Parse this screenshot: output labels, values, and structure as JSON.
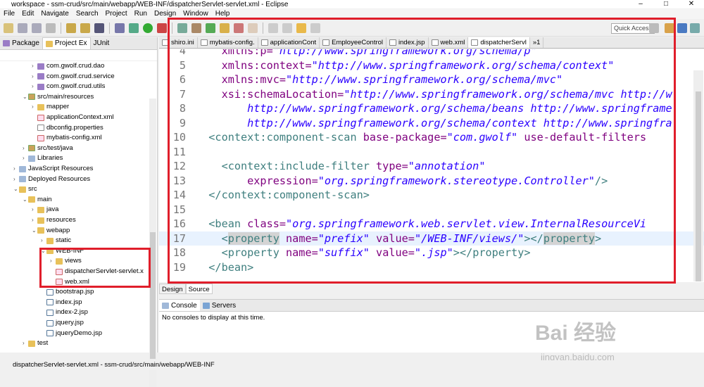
{
  "window": {
    "title": "workspace - ssm-crud/src/main/webapp/WEB-INF/dispatcherServlet-servlet.xml - Eclipse",
    "controls": [
      "–",
      "□",
      "✕"
    ]
  },
  "menu": [
    "File",
    "Edit",
    "Navigate",
    "Search",
    "Project",
    "Run",
    "Design",
    "Window",
    "Help"
  ],
  "quick_access": {
    "placeholder": "Quick Access"
  },
  "left_panel": {
    "tabs": [
      "Package",
      "Project Ex",
      "JUnit"
    ],
    "tree": [
      {
        "label": "com.gwolf.crud.dao",
        "icon": "pkg",
        "indent": 3,
        "arrow": "›"
      },
      {
        "label": "com.gwolf.crud.service",
        "icon": "pkg",
        "indent": 3,
        "arrow": "›"
      },
      {
        "label": "com.gwolf.crud.utils",
        "icon": "pkg",
        "indent": 3,
        "arrow": "›"
      },
      {
        "label": "src/main/resources",
        "icon": "src",
        "indent": 2,
        "arrow": "⌄"
      },
      {
        "label": "mapper",
        "icon": "folder",
        "indent": 3,
        "arrow": "›"
      },
      {
        "label": "applicationContext.xml",
        "icon": "xml",
        "indent": 3,
        "arrow": ""
      },
      {
        "label": "dbconfig.properties",
        "icon": "file",
        "indent": 3,
        "arrow": ""
      },
      {
        "label": "mybatis-config.xml",
        "icon": "xml",
        "indent": 3,
        "arrow": ""
      },
      {
        "label": "src/test/java",
        "icon": "src",
        "indent": 2,
        "arrow": "›"
      },
      {
        "label": "Libraries",
        "icon": "lib",
        "indent": 2,
        "arrow": "›"
      },
      {
        "label": "JavaScript Resources",
        "icon": "lib",
        "indent": 1,
        "arrow": "›"
      },
      {
        "label": "Deployed Resources",
        "icon": "lib",
        "indent": 1,
        "arrow": "›"
      },
      {
        "label": "src",
        "icon": "folder",
        "indent": 1,
        "arrow": "⌄"
      },
      {
        "label": "main",
        "icon": "folder",
        "indent": 2,
        "arrow": "⌄"
      },
      {
        "label": "java",
        "icon": "folder",
        "indent": 3,
        "arrow": "›"
      },
      {
        "label": "resources",
        "icon": "folder",
        "indent": 3,
        "arrow": "›"
      },
      {
        "label": "webapp",
        "icon": "folder",
        "indent": 3,
        "arrow": "⌄"
      },
      {
        "label": "static",
        "icon": "folder",
        "indent": 4,
        "arrow": "›"
      },
      {
        "label": "WEB-INF",
        "icon": "folder",
        "indent": 4,
        "arrow": "⌄"
      },
      {
        "label": "views",
        "icon": "folder",
        "indent": 5,
        "arrow": "›"
      },
      {
        "label": "dispatcherServlet-servlet.x",
        "icon": "xml",
        "indent": 5,
        "arrow": ""
      },
      {
        "label": "web.xml",
        "icon": "xml",
        "indent": 5,
        "arrow": ""
      },
      {
        "label": "bootstrap.jsp",
        "icon": "jsp",
        "indent": 4,
        "arrow": ""
      },
      {
        "label": "index.jsp",
        "icon": "jsp",
        "indent": 4,
        "arrow": ""
      },
      {
        "label": "index-2.jsp",
        "icon": "jsp",
        "indent": 4,
        "arrow": ""
      },
      {
        "label": "jquery.jsp",
        "icon": "jsp",
        "indent": 4,
        "arrow": ""
      },
      {
        "label": "jqueryDemo.jsp",
        "icon": "jsp",
        "indent": 4,
        "arrow": ""
      },
      {
        "label": "test",
        "icon": "folder",
        "indent": 2,
        "arrow": "›"
      }
    ]
  },
  "editor_tabs": [
    {
      "label": "shiro.ini",
      "active": false
    },
    {
      "label": "mybatis-config.",
      "active": false
    },
    {
      "label": "applicationCont",
      "active": false
    },
    {
      "label": "EmployeeControl",
      "active": false
    },
    {
      "label": "index.jsp",
      "active": false
    },
    {
      "label": "web.xml",
      "active": false
    },
    {
      "label": "dispatcherServl",
      "active": true
    },
    {
      "label": "»1",
      "active": false
    }
  ],
  "code_lines": [
    {
      "n": "4",
      "html": "<span class=\"a\">    xmlns:p=</span><span class=\"v\">\"http://www.springframework.org/schema/p\"</span>"
    },
    {
      "n": "5",
      "html": "<span class=\"a\">    xmlns:context=</span><span class=\"v\">\"http://www.springframework.org/schema/context\"</span>"
    },
    {
      "n": "6",
      "html": "<span class=\"a\">    xmlns:mvc=</span><span class=\"v\">\"http://www.springframework.org/schema/mvc\"</span>"
    },
    {
      "n": "7",
      "html": "<span class=\"a\">    xsi:schemaLocation=</span><span class=\"v\">\"http://www.springframework.org/schema/mvc http://w</span>"
    },
    {
      "n": "8",
      "html": "<span class=\"v\">        http://www.springframework.org/schema/beans http://www.springframe</span>"
    },
    {
      "n": "9",
      "html": "<span class=\"v\">        http://www.springframework.org/schema/context http://www.springfra</span>"
    },
    {
      "n": "10",
      "html": "<span class=\"t\">  &lt;context:component-scan </span><span class=\"a\">base-package=</span><span class=\"v\">\"com.gwolf\"</span> <span class=\"a\">use-default-filters</span>"
    },
    {
      "n": "11",
      "html": ""
    },
    {
      "n": "12",
      "html": "<span class=\"t\">    &lt;context:include-filter </span><span class=\"a\">type=</span><span class=\"v\">\"annotation\"</span>"
    },
    {
      "n": "13",
      "html": "<span class=\"a\">        expression=</span><span class=\"v\">\"org.springframework.stereotype.Controller\"</span><span class=\"t\">/&gt;</span>"
    },
    {
      "n": "14",
      "html": "<span class=\"t\">  &lt;/context:component-scan&gt;</span>"
    },
    {
      "n": "15",
      "html": ""
    },
    {
      "n": "16",
      "html": "<span class=\"t\">  &lt;bean </span><span class=\"a\">class=</span><span class=\"v\">\"org.springframework.web.servlet.view.InternalResourceVi</span>"
    },
    {
      "n": "17",
      "html": "<span class=\"t\">    &lt;</span><span class=\"t hl\">property</span> <span class=\"a\">name=</span><span class=\"v\">\"prefix\"</span> <span class=\"a\">value=</span><span class=\"v\">\"/WEB-INF/views/\"</span><span class=\"t\">&gt;&lt;/</span><span class=\"t hl\">property</span><span class=\"t\">&gt;</span>"
    },
    {
      "n": "18",
      "html": "<span class=\"t\">    &lt;property </span><span class=\"a\">name=</span><span class=\"v\">\"suffix\"</span> <span class=\"a\">value=</span><span class=\"v\">\".jsp\"</span><span class=\"t\">&gt;&lt;/property&gt;</span>"
    },
    {
      "n": "19",
      "html": "<span class=\"t\">  &lt;/bean&gt;</span>"
    }
  ],
  "editor_bottom_tabs": [
    "Design",
    "Source"
  ],
  "console": {
    "tabs": [
      "Console",
      "Servers"
    ],
    "message": "No consoles to display at this time."
  },
  "status": "dispatcherServlet-servlet.xml - ssm-crud/src/main/webapp/WEB-INF",
  "watermark": {
    "main": "Bai 经验",
    "sub": "jingyan.baidu.com"
  },
  "colors": {
    "annotation_box": "#e01e2b",
    "tag": "#3f7f7f",
    "attr": "#7f007f",
    "value": "#2a00ff"
  }
}
